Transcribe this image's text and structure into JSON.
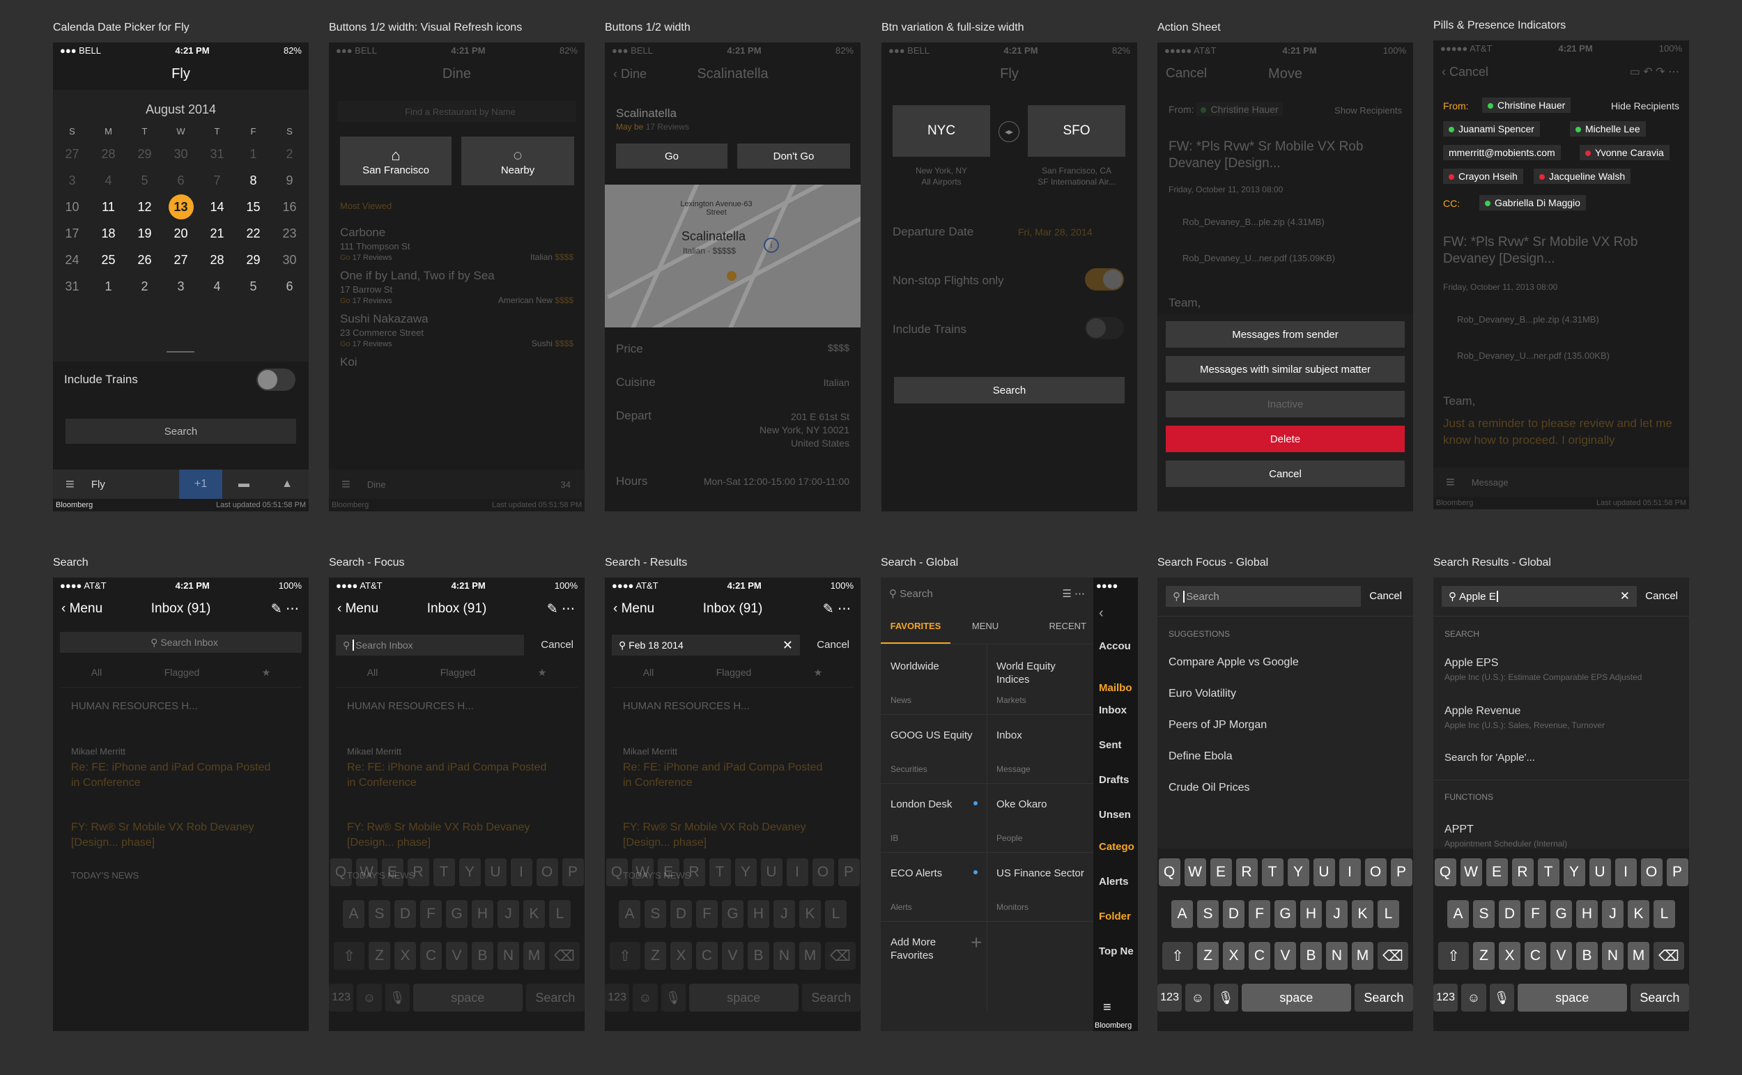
{
  "titles": [
    "Calenda Date Picker for Fly",
    "Buttons 1/2 width: Visual Refresh icons",
    "Buttons 1/2 width",
    "Btn variation & full-size width",
    "Action Sheet",
    "Pills & Presence Indicators",
    "Search",
    "Search - Focus",
    "Search - Results",
    "Search - Global",
    "Search Focus - Global",
    "Search Results - Global"
  ],
  "status": {
    "bell": "BELL",
    "att": "AT&T",
    "time": "4:21 PM",
    "batt82": "82%",
    "batt100": "100%"
  },
  "common": {
    "bloomberg": "Bloomberg",
    "last_updated": "Last updated 05:51:58 PM",
    "search": "Search",
    "cancel": "Cancel",
    "menu": "Menu",
    "inbox": "Inbox (91)",
    "search_inbox": "Search Inbox"
  },
  "fly": {
    "title": "Fly",
    "month": "August 2014",
    "weekdays": [
      "S",
      "M",
      "T",
      "W",
      "T",
      "F",
      "S"
    ],
    "weeks": [
      [
        "27",
        "28",
        "29",
        "30",
        "31",
        "1",
        "2"
      ],
      [
        "3",
        "4",
        "5",
        "6",
        "7",
        "8",
        "9"
      ],
      [
        "10",
        "11",
        "12",
        "13",
        "14",
        "15",
        "16"
      ],
      [
        "17",
        "18",
        "19",
        "20",
        "21",
        "22",
        "23"
      ],
      [
        "24",
        "25",
        "26",
        "27",
        "28",
        "29",
        "30"
      ],
      [
        "31",
        "1",
        "2",
        "3",
        "4",
        "5",
        "6"
      ]
    ],
    "include_trains": "Include Trains",
    "tab_label": "Fly",
    "badge": "+1"
  },
  "dine": {
    "title": "Dine",
    "find_placeholder": "Find a Restaurant by Name",
    "sf": "San Francisco",
    "nearby": "Nearby",
    "most_viewed": "Most Viewed",
    "restaurants": [
      {
        "name": "Carbone",
        "addr": "111 Thompson St",
        "reviews": "17 Reviews",
        "type": "Italian",
        "price": "$$$$"
      },
      {
        "name": "One if by Land, Two if by Sea",
        "addr": "17 Barrow St",
        "reviews": "17 Reviews",
        "type": "American New",
        "price": "$$$$"
      },
      {
        "name": "Sushi Nakazawa",
        "addr": "23 Commerce Street",
        "reviews": "17 Reviews",
        "type": "Sushi",
        "price": "$$$$"
      },
      {
        "name": "Koi",
        "addr": "",
        "reviews": "",
        "type": "",
        "price": ""
      }
    ],
    "go_label": "Go",
    "tab_dine": "Dine",
    "tab_count": "34"
  },
  "scal": {
    "back": "Dine",
    "title": "Scalinatella",
    "name": "Scalinatella",
    "maybe": "May be",
    "reviews": "17 Reviews",
    "go": "Go",
    "dont_go": "Don't Go",
    "map_title": "Scalinatella",
    "map_sub": "Italian · $$$$$",
    "map_street": "Lexington Avenue-63 Street",
    "price_label": "Price",
    "price_val": "$$$$",
    "cuisine_label": "Cuisine",
    "cuisine_val": "Italian",
    "depart_label": "Depart",
    "addr1": "201 E 61st St",
    "addr2": "New York, NY 10021",
    "addr3": "United States",
    "hours_label": "Hours",
    "hours_val": "Mon-Sat  12:00-15:00  17:00-11:00"
  },
  "flyfull": {
    "title": "Fly",
    "from": "NYC",
    "to": "SFO",
    "from_sub1": "New York, NY",
    "from_sub2": "All Airports",
    "to_sub1": "San Francisco, CA",
    "to_sub2": "SF International Air...",
    "departure_label": "Departure Date",
    "departure_val": "Fri, Mar 28, 2014",
    "nonstop": "Non-stop Flights only",
    "include_trains": "Include Trains",
    "search": "Search"
  },
  "action": {
    "cancel": "Cancel",
    "move": "Move",
    "from_label": "From:",
    "from_name": "Christine Hauer",
    "show_recipients": "Show Recipients",
    "subject": "FW: *Pls Rvw* Sr Mobile VX Rob Devaney [Design...",
    "date": "Friday, October 11, 2013  08:00",
    "att1": "Rob_Devaney_B...ple.zip (4.31MB)",
    "att2": "Rob_Devaney_U...ner.pdf (135.09KB)",
    "body": "Team,",
    "opt1": "Messages from sender",
    "opt2": "Messages with similar subject matter",
    "opt3": "Inactive",
    "opt_delete": "Delete",
    "opt_cancel": "Cancel"
  },
  "pills": {
    "cancel": "Cancel",
    "from_label": "From:",
    "cc_label": "CC:",
    "hide_recipients": "Hide Recipients",
    "from_pill": "Christine Hauer",
    "to_pills": [
      "Juanami Spencer",
      "Michelle Lee",
      "mmerritt@mobients.com",
      "Yvonne Caravia",
      "Crayon Hseih",
      "Jacqueline Walsh"
    ],
    "cc_pill": "Gabriella Di Maggio",
    "subject": "FW: *Pls Rvw* Sr Mobile VX Rob Devaney [Design...",
    "date": "Friday, October 11, 2013  08:00",
    "att1": "Rob_Devaney_B...ple.zip (4.31MB)",
    "att2": "Rob_Devaney_U...ner.pdf (135.00KB)",
    "body1": "Team,",
    "body2": "Just a reminder to please review and let me know how to proceed. I originally",
    "message": "Message",
    "colors": {
      "online": "#3ccf4e",
      "busy": "#e8273c"
    }
  },
  "inbox_bg": {
    "tabs": [
      "All",
      "Flagged",
      "★"
    ],
    "item1": "HUMAN RESOURCES H...",
    "sender": "Mikael Merritt",
    "item2": "Re: FE: iPhone and iPad Compa Posted in Conference",
    "item3": "FY: Rw® Sr Mobile VX Rob Devaney [Design... phase]",
    "news": "TODAY'S NEWS"
  },
  "focus": {
    "placeholder": "Search Inbox",
    "results_value": "Feb 18 2014"
  },
  "keyboard": {
    "row1": [
      "Q",
      "W",
      "E",
      "R",
      "T",
      "Y",
      "U",
      "I",
      "O",
      "P"
    ],
    "row2": [
      "A",
      "S",
      "D",
      "F",
      "G",
      "H",
      "J",
      "K",
      "L"
    ],
    "row3": [
      "Z",
      "X",
      "C",
      "V",
      "B",
      "N",
      "M"
    ],
    "num": "123",
    "space": "space",
    "search": "Search"
  },
  "global": {
    "search": "Search",
    "tabs": [
      "FAVORITES",
      "MENU",
      "RECENT"
    ],
    "cells": [
      {
        "title": "Worldwide",
        "sub": "News"
      },
      {
        "title": "World Equity Indices",
        "sub": "Markets"
      },
      {
        "title": "GOOG US Equity",
        "sub": "Securities"
      },
      {
        "title": "Inbox",
        "sub": "Message"
      },
      {
        "title": "London Desk",
        "sub": "IB"
      },
      {
        "title": "Oke Okaro",
        "sub": "People"
      },
      {
        "title": "ECO Alerts",
        "sub": "Alerts"
      },
      {
        "title": "US Finance Sector",
        "sub": "Monitors"
      },
      {
        "title": "Add More Favorites",
        "sub": ""
      }
    ],
    "side": [
      "Accou",
      "Mailbo",
      "Inbox",
      "Sent",
      "Drafts",
      "Unsen",
      "Catego",
      "Alerts",
      "Folder",
      "Top Ne"
    ],
    "accent": "#f5a623",
    "dot_color": "#4a9fe8"
  },
  "gfocus": {
    "placeholder": "Search",
    "suggestions_label": "SUGGESTIONS",
    "suggestions": [
      "Compare Apple vs Google",
      "Euro Volatility",
      "Peers of JP Morgan",
      "Define Ebola",
      "Crude Oil Prices"
    ]
  },
  "gresults": {
    "value": "Apple E",
    "search_label": "SEARCH",
    "r1": "Apple EPS",
    "r1_sub": "Apple Inc (U.S.): Estimate Comparable EPS Adjusted",
    "r2": "Apple Revenue",
    "r2_sub": "Apple Inc (U.S.): Sales, Revenue, Turnover",
    "search_for": "Search for 'Apple'...",
    "functions_label": "FUNCTIONS",
    "f1": "APPT",
    "f1_sub": "Appointment Scheduler (Internal)"
  }
}
